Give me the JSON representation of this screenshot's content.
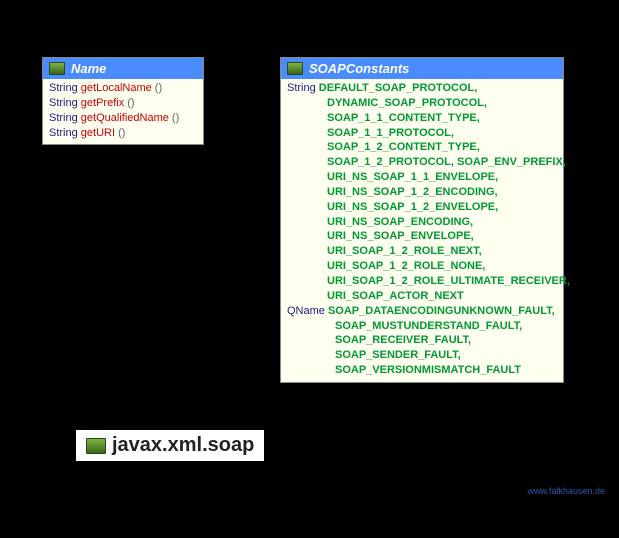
{
  "name_box": {
    "title": "Name",
    "methods": [
      {
        "type": "String",
        "name": "getLocalName"
      },
      {
        "type": "String",
        "name": "getPrefix"
      },
      {
        "type": "String",
        "name": "getQualifiedName"
      },
      {
        "type": "String",
        "name": "getURI"
      }
    ]
  },
  "soap_box": {
    "title": "SOAPConstants",
    "string_constants": [
      "DEFAULT_SOAP_PROTOCOL,",
      "DYNAMIC_SOAP_PROTOCOL,",
      "SOAP_1_1_CONTENT_TYPE,",
      "SOAP_1_1_PROTOCOL,",
      "SOAP_1_2_CONTENT_TYPE,",
      "SOAP_1_2_PROTOCOL, SOAP_ENV_PREFIX,",
      "URI_NS_SOAP_1_1_ENVELOPE,",
      "URI_NS_SOAP_1_2_ENCODING,",
      "URI_NS_SOAP_1_2_ENVELOPE,",
      "URI_NS_SOAP_ENCODING,",
      "URI_NS_SOAP_ENVELOPE,",
      "URI_SOAP_1_2_ROLE_NEXT,",
      "URI_SOAP_1_2_ROLE_NONE,",
      "URI_SOAP_1_2_ROLE_ULTIMATE_RECEIVER,",
      "URI_SOAP_ACTOR_NEXT"
    ],
    "qname_constants": [
      "SOAP_DATAENCODINGUNKNOWN_FAULT,",
      "SOAP_MUSTUNDERSTAND_FAULT,",
      "SOAP_RECEIVER_FAULT,",
      "SOAP_SENDER_FAULT,",
      "SOAP_VERSIONMISMATCH_FAULT"
    ],
    "type_string": "String",
    "type_qname": "QName"
  },
  "package_name": "javax.xml.soap",
  "credit": "www.falkhausen.de"
}
